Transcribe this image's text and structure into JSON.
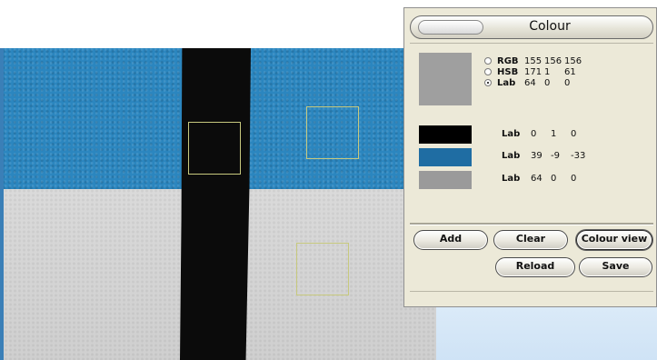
{
  "panel": {
    "title": "Colour",
    "current_swatch_color": "#9f9f9f",
    "modes": [
      {
        "label": "RGB",
        "values": [
          "155",
          "156",
          "156"
        ],
        "selected": false
      },
      {
        "label": "HSB",
        "values": [
          "171",
          "1",
          "61"
        ],
        "selected": false
      },
      {
        "label": "Lab",
        "values": [
          "64",
          "0",
          "0"
        ],
        "selected": true
      }
    ],
    "samples": [
      {
        "color": "#000000",
        "label": "Lab",
        "values": [
          "0",
          "1",
          "0"
        ]
      },
      {
        "color": "#1f6da3",
        "label": "Lab",
        "values": [
          "39",
          "-9",
          "-33"
        ]
      },
      {
        "color": "#9a9a9a",
        "label": "Lab",
        "values": [
          "64",
          "0",
          "0"
        ]
      }
    ],
    "buttons": {
      "add": "Add",
      "clear": "Clear",
      "colour_view": "Colour view",
      "reload": "Reload",
      "save": "Save"
    }
  },
  "colors": {
    "blue_region": "#2b86bf",
    "gray_region": "#d4d4d4",
    "stripe": "#0b0b0b",
    "selection_box": "#c7c97e",
    "panel_bg": "#ece9d8"
  }
}
